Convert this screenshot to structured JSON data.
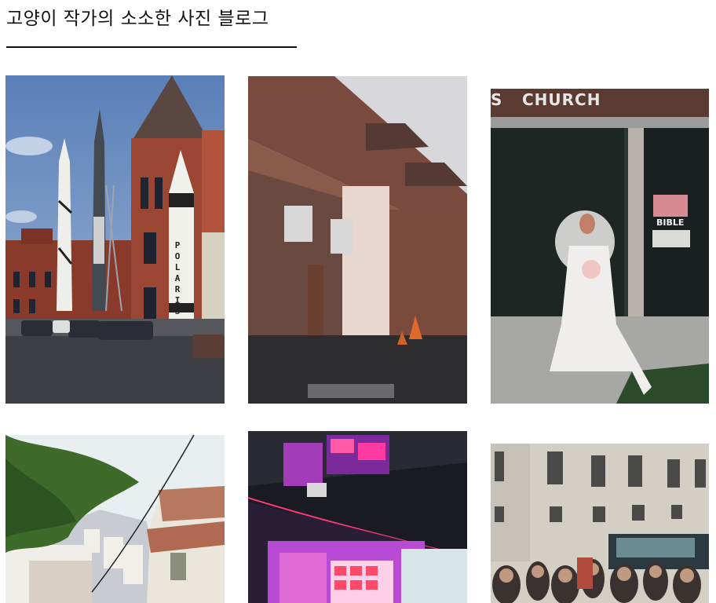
{
  "blog": {
    "title": "고양이 작가의 소소한 사진 블로그"
  },
  "gallery": {
    "photos": [
      {
        "subject": "rockets in front of red brick building",
        "sign_text": "POLARIS"
      },
      {
        "subject": "brick warehouse wall with air conditioners and traffic cones"
      },
      {
        "subject": "bride in white dress in front of church",
        "sign_text": "CHURCH",
        "sign_prefix": "S",
        "poster_text": "BIBLE"
      },
      {
        "subject": "hillside town with white buildings and tree branches"
      },
      {
        "subject": "neon lit arcade storefront"
      },
      {
        "subject": "crowd in front of classical building with bus"
      }
    ]
  },
  "colors": {
    "text": "#111111",
    "background": "#ffffff"
  }
}
